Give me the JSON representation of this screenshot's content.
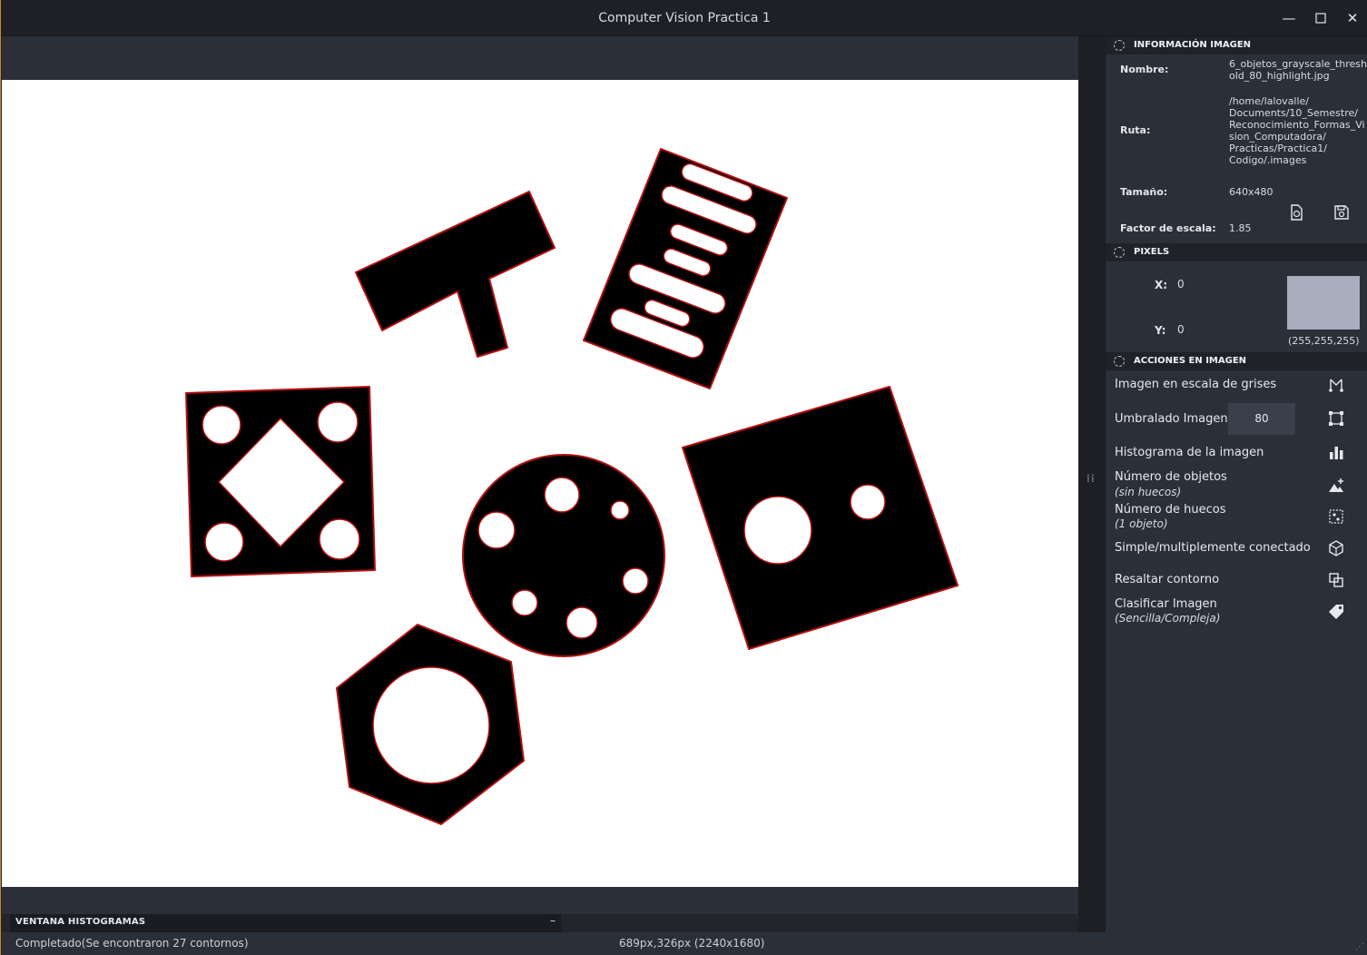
{
  "window": {
    "title": "Computer Vision Practica 1",
    "minimize": "—",
    "maximize": "⎕",
    "close": "✕"
  },
  "info": {
    "section_title": "INFORMACIÓN IMAGEN",
    "name_label": "Nombre:",
    "name_value": "6_objetos_grayscale_threshold_80_highlight.jpg",
    "name_lines": [
      "6_objetos_grayscale_thresh",
      "old_80_highlight.jpg"
    ],
    "path_label": "Ruta:",
    "path_lines": [
      "/home/lalovalle/",
      "Documents/10_Semestre/",
      "Reconocimiento_Formas_Vi",
      "sion_Computadora/",
      "Practicas/Practica1/",
      "Codigo/.images"
    ],
    "size_label": "Tamaño:",
    "size_value": "640x480",
    "scale_label": "Factor de escala:",
    "scale_value": "1.85"
  },
  "pixels": {
    "section_title": "PIXELS",
    "x_label": "X:",
    "x_value": "0",
    "y_label": "Y:",
    "y_value": "0",
    "rgb": "(255,255,255)",
    "swatch_color": "#a8acbb"
  },
  "actions": {
    "section_title": "ACCIONES EN IMAGEN",
    "grayscale": "Imagen en escala de grises",
    "threshold": "Umbralado Imagen",
    "threshold_value": "80",
    "histogram": "Histograma de la imagen",
    "num_objects": "Número de objetos",
    "num_objects_sub": "(sin huecos)",
    "num_holes": "Número de huecos",
    "num_holes_sub": "(1 objeto)",
    "connected": "Simple/multiplemente conectado",
    "contour": "Resaltar contorno",
    "classify": "Clasificar Imagen",
    "classify_sub": "(Sencilla/Compleja)"
  },
  "histogram_window": {
    "title": "VENTANA HISTOGRAMAS",
    "collapse": "–"
  },
  "status": {
    "message": "Completado(Se encontraron 27 contornos)",
    "coords": "689px,326px (2240x1680)"
  }
}
